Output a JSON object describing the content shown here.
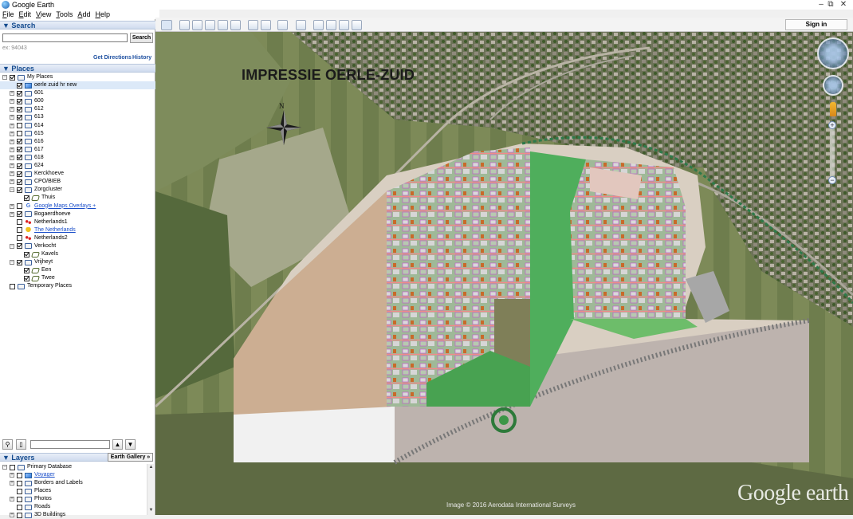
{
  "window": {
    "title": "Google Earth",
    "minimize": "–",
    "restore": "⧉",
    "close": "✕"
  },
  "menu": [
    {
      "label": "File",
      "key": "F",
      "rest": "ile"
    },
    {
      "label": "Edit",
      "key": "E",
      "rest": "dit"
    },
    {
      "label": "View",
      "key": "V",
      "rest": "iew"
    },
    {
      "label": "Tools",
      "key": "T",
      "rest": "ools"
    },
    {
      "label": "Add",
      "key": "A",
      "rest": "dd"
    },
    {
      "label": "Help",
      "key": "H",
      "rest": "elp"
    }
  ],
  "toolbar": {
    "signin_label": "Sign in"
  },
  "search": {
    "header": "▼ Search",
    "value": "",
    "button_label": "Search",
    "hint": "ex: 94043",
    "directions_label": "Get Directions",
    "history_label": "History"
  },
  "places": {
    "header": "▼ Places",
    "items": [
      {
        "label": "My Places",
        "level": 0,
        "exp": "−",
        "checked": true,
        "icon": "folder"
      },
      {
        "label": "oerle zuid hr new",
        "level": 1,
        "exp": "",
        "checked": true,
        "icon": "overlay",
        "selected": true
      },
      {
        "label": "601",
        "level": 1,
        "exp": "+",
        "checked": true,
        "icon": "folder"
      },
      {
        "label": "600",
        "level": 1,
        "exp": "+",
        "checked": true,
        "icon": "folder"
      },
      {
        "label": "612",
        "level": 1,
        "exp": "+",
        "checked": true,
        "icon": "folder"
      },
      {
        "label": "613",
        "level": 1,
        "exp": "+",
        "checked": true,
        "icon": "folder"
      },
      {
        "label": "614",
        "level": 1,
        "exp": "+",
        "checked": false,
        "icon": "folder"
      },
      {
        "label": "615",
        "level": 1,
        "exp": "+",
        "checked": false,
        "icon": "folder"
      },
      {
        "label": "616",
        "level": 1,
        "exp": "+",
        "checked": true,
        "icon": "folder"
      },
      {
        "label": "617",
        "level": 1,
        "exp": "+",
        "checked": true,
        "icon": "folder"
      },
      {
        "label": "618",
        "level": 1,
        "exp": "+",
        "checked": true,
        "icon": "folder"
      },
      {
        "label": "624",
        "level": 1,
        "exp": "+",
        "checked": true,
        "icon": "folder"
      },
      {
        "label": "Kerckhoeve",
        "level": 1,
        "exp": "+",
        "checked": true,
        "icon": "folder"
      },
      {
        "label": "CPO/BIEB",
        "level": 1,
        "exp": "+",
        "checked": true,
        "icon": "folder"
      },
      {
        "label": "Zorgcluster",
        "level": 1,
        "exp": "−",
        "checked": true,
        "icon": "folder"
      },
      {
        "label": "Thuis",
        "level": 2,
        "exp": "",
        "checked": true,
        "icon": "poly"
      },
      {
        "label": "Google Maps Overlays +",
        "level": 1,
        "exp": "+",
        "checked": false,
        "icon": "g",
        "link": true
      },
      {
        "label": "Bogaerdhoeve",
        "level": 1,
        "exp": "+",
        "checked": true,
        "icon": "folder"
      },
      {
        "label": "Netherlands1",
        "level": 1,
        "exp": "",
        "checked": false,
        "icon": "net"
      },
      {
        "label": "The Netherlands",
        "level": 1,
        "exp": "",
        "checked": false,
        "icon": "pin",
        "link": true
      },
      {
        "label": "Netherlands2",
        "level": 1,
        "exp": "",
        "checked": false,
        "icon": "net"
      },
      {
        "label": "Verkocht",
        "level": 1,
        "exp": "−",
        "checked": true,
        "icon": "folder"
      },
      {
        "label": "Kavels",
        "level": 2,
        "exp": "",
        "checked": true,
        "icon": "poly"
      },
      {
        "label": "Vrijheyt",
        "level": 1,
        "exp": "−",
        "checked": true,
        "icon": "folder"
      },
      {
        "label": "Een",
        "level": 2,
        "exp": "",
        "checked": true,
        "icon": "poly"
      },
      {
        "label": "Twee",
        "level": 2,
        "exp": "",
        "checked": true,
        "icon": "poly"
      },
      {
        "label": "Temporary Places",
        "level": 0,
        "exp": "",
        "checked": false,
        "icon": "folder"
      }
    ]
  },
  "places_tools": {
    "search_value": "",
    "up": "▲",
    "down": "▼"
  },
  "layers": {
    "header": "▼ Layers",
    "gallery_label": "Earth Gallery »",
    "items": [
      {
        "label": "Primary Database",
        "level": 0,
        "exp": "−",
        "checked": false,
        "icon": "folder"
      },
      {
        "label": "Voyager",
        "level": 1,
        "exp": "+",
        "checked": false,
        "icon": "overlay",
        "link": true
      },
      {
        "label": "Borders and Labels",
        "level": 1,
        "exp": "+",
        "checked": false,
        "icon": "folder"
      },
      {
        "label": "Places",
        "level": 1,
        "exp": "",
        "checked": false,
        "icon": "folder"
      },
      {
        "label": "Photos",
        "level": 1,
        "exp": "+",
        "checked": false,
        "icon": "folder"
      },
      {
        "label": "Roads",
        "level": 1,
        "exp": "",
        "checked": false,
        "icon": "folder"
      },
      {
        "label": "3D Buildings",
        "level": 1,
        "exp": "+",
        "checked": false,
        "icon": "folder"
      }
    ]
  },
  "map": {
    "overlay_title": "IMPRESSIE OERLE-ZUID",
    "compass_letter": "N",
    "imagery_credit": "Image © 2016 Aerodata International Surveys",
    "logo_text": "Google earth",
    "zoom_in": "+",
    "zoom_out": "−"
  }
}
